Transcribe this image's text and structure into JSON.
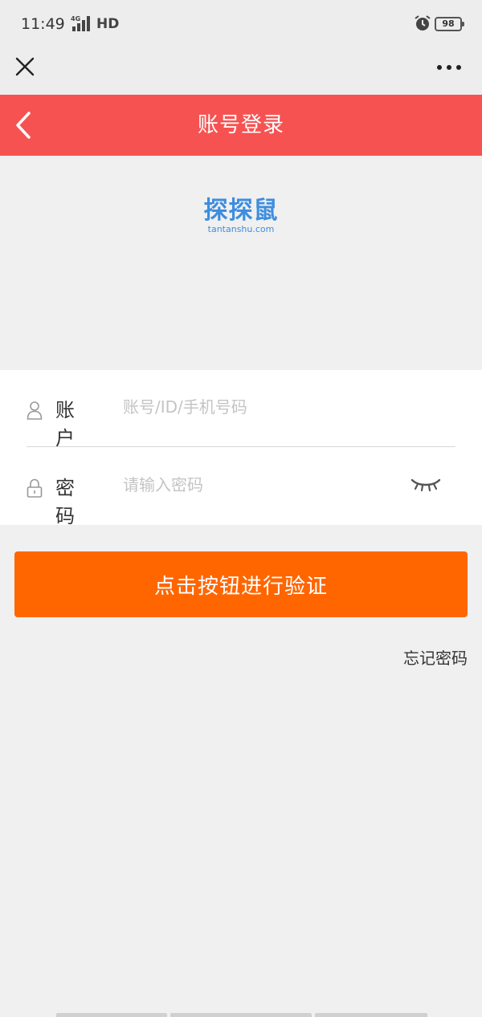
{
  "status_bar": {
    "time": "11:49",
    "network": "4G",
    "hd": "HD",
    "battery": "98",
    "icons": [
      "signal-icon",
      "alarm-icon",
      "battery-icon"
    ]
  },
  "wechat_bar": {
    "icons": [
      "close-icon",
      "more-icon"
    ]
  },
  "header": {
    "title": "账号登录",
    "back_icon": "chevron-left-icon",
    "background": "#f75252"
  },
  "logo": {
    "text_cn": "探探鼠",
    "text_en": "tantanshu.com",
    "color": "#3d8de0"
  },
  "form": {
    "account": {
      "label": "账 户",
      "placeholder": "账号/ID/手机号码",
      "value": "",
      "icon": "user-icon"
    },
    "password": {
      "label": "密 码",
      "placeholder": "请输入密码",
      "value": "",
      "icon": "lock-icon",
      "toggle_icon": "eye-closed-icon"
    }
  },
  "submit": {
    "label": "点击按钮进行验证",
    "color": "#ff6600"
  },
  "forgot_password": "忘记密码"
}
